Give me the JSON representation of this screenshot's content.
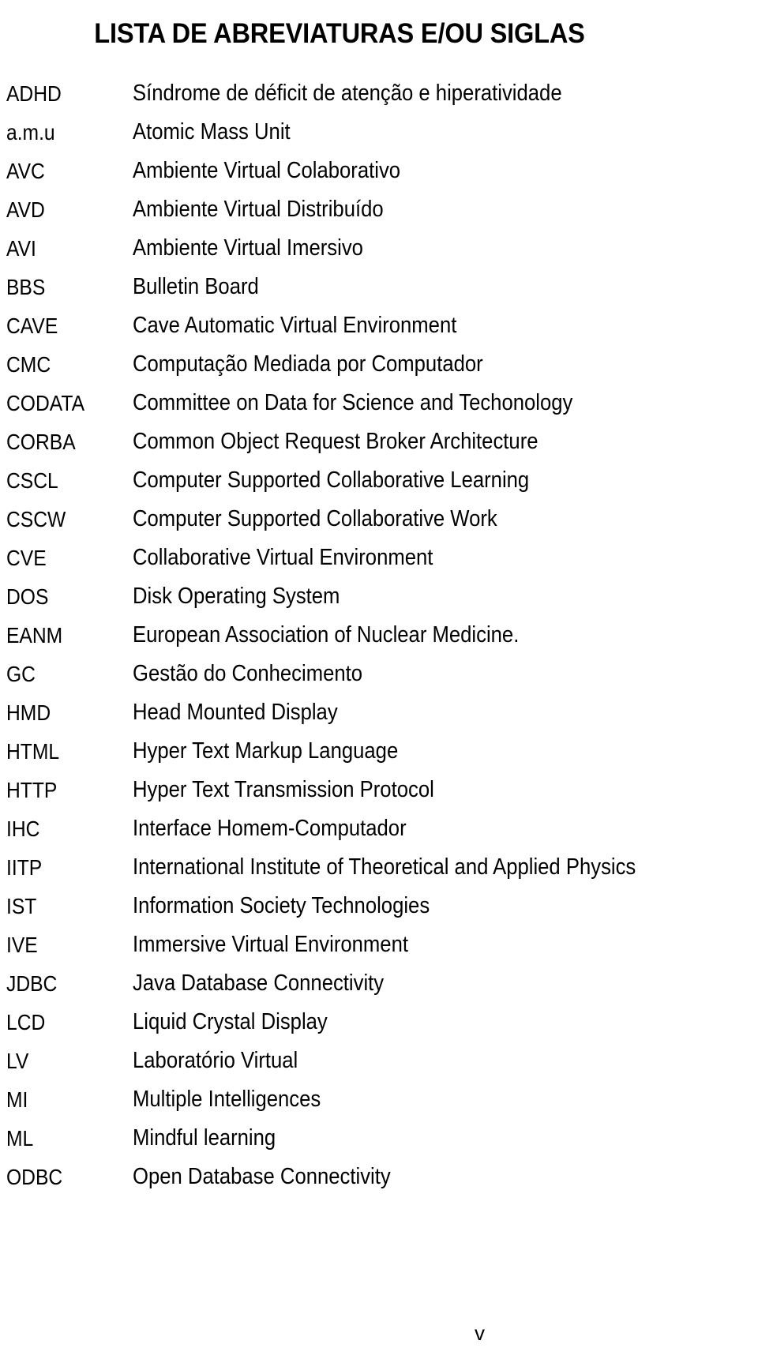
{
  "document": {
    "title": "LISTA DE ABREVIATURAS E/OU SIGLAS",
    "page_number": "v"
  },
  "abbreviations": [
    {
      "term": "ADHD",
      "definition": "Síndrome de déficit de atenção e hiperatividade"
    },
    {
      "term": "a.m.u",
      "definition": "Atomic Mass Unit"
    },
    {
      "term": "AVC",
      "definition": "Ambiente Virtual Colaborativo"
    },
    {
      "term": "AVD",
      "definition": "Ambiente Virtual Distribuído"
    },
    {
      "term": "AVI",
      "definition": "Ambiente Virtual Imersivo"
    },
    {
      "term": "BBS",
      "definition": "Bulletin Board"
    },
    {
      "term": "CAVE",
      "definition": "Cave Automatic Virtual Environment"
    },
    {
      "term": "CMC",
      "definition": "Computação Mediada por Computador"
    },
    {
      "term": "CODATA",
      "definition": "Committee on Data for Science and Techonology"
    },
    {
      "term": "CORBA",
      "definition": "Common Object Request Broker Architecture"
    },
    {
      "term": "CSCL",
      "definition": "Computer Supported Collaborative Learning"
    },
    {
      "term": "CSCW",
      "definition": "Computer Supported Collaborative Work"
    },
    {
      "term": "CVE",
      "definition": "Collaborative Virtual Environment"
    },
    {
      "term": "DOS",
      "definition": "Disk Operating System"
    },
    {
      "term": "EANM",
      "definition": "European Association of Nuclear Medicine."
    },
    {
      "term": "GC",
      "definition": "Gestão do Conhecimento"
    },
    {
      "term": "HMD",
      "definition": "Head Mounted Display"
    },
    {
      "term": "HTML",
      "definition": "Hyper Text Markup Language"
    },
    {
      "term": "HTTP",
      "definition": "Hyper Text Transmission Protocol"
    },
    {
      "term": "IHC",
      "definition": "Interface Homem-Computador"
    },
    {
      "term": "IITP",
      "definition": "International Institute of Theoretical and Applied Physics"
    },
    {
      "term": "IST",
      "definition": "Information Society Technologies"
    },
    {
      "term": "IVE",
      "definition": "Immersive Virtual Environment"
    },
    {
      "term": "JDBC",
      "definition": "Java Database Connectivity"
    },
    {
      "term": "LCD",
      "definition": "Liquid Crystal Display"
    },
    {
      "term": "LV",
      "definition": "Laboratório Virtual"
    },
    {
      "term": "MI",
      "definition": "Multiple Intelligences"
    },
    {
      "term": "ML",
      "definition": "Mindful learning"
    },
    {
      "term": "ODBC",
      "definition": "Open Database Connectivity"
    }
  ]
}
